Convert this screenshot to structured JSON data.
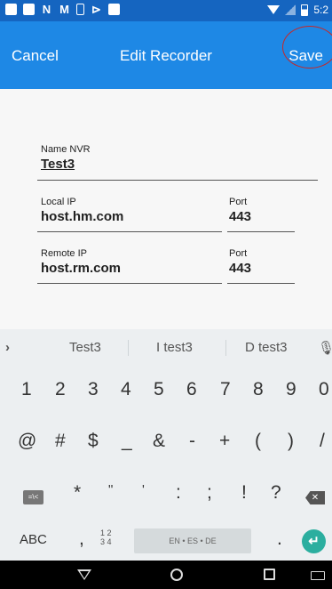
{
  "status_bar": {
    "time": "5:2",
    "left_icons": [
      "app-icon",
      "image-icon",
      "n-icon",
      "m-icon",
      "phone-icon",
      "flag-icon",
      "video-icon"
    ],
    "right_icons": [
      "wifi-icon",
      "signal-icon",
      "battery-icon"
    ]
  },
  "toolbar": {
    "cancel_label": "Cancel",
    "title": "Edit Recorder",
    "save_label": "Save",
    "accent_color": "#1E88E5",
    "highlight_color": "#C62828"
  },
  "form": {
    "name_label": "Name NVR",
    "name_value": "Test3",
    "local_ip_label": "Local IP",
    "local_ip_value": "host.hm.com",
    "local_port_label": "Port",
    "local_port_value": "443",
    "remote_ip_label": "Remote IP",
    "remote_ip_value": "host.rm.com",
    "remote_port_label": "Port",
    "remote_port_value": "443"
  },
  "keyboard": {
    "suggestions": [
      "Test3",
      "I test3",
      "D test3"
    ],
    "row_numbers": [
      "1",
      "2",
      "3",
      "4",
      "5",
      "6",
      "7",
      "8",
      "9",
      "0"
    ],
    "row_symbols1": [
      "@",
      "#",
      "$",
      "_",
      "&",
      "-",
      "+",
      "(",
      ")",
      "/"
    ],
    "row_symbols2": [
      "*",
      "\"",
      "'",
      ":",
      ";",
      "!",
      "?"
    ],
    "symbols_key_label": "=\\<",
    "abc_label": "ABC",
    "comma_label": ",",
    "fraction_top": "1 2",
    "fraction_bottom": "3 4",
    "space_label": "EN • ES • DE",
    "period_label": ".",
    "enter_color": "#2BAE9F"
  },
  "nav_bar": {
    "buttons": [
      "back-icon",
      "home-icon",
      "recents-icon",
      "keyboard-icon"
    ]
  }
}
